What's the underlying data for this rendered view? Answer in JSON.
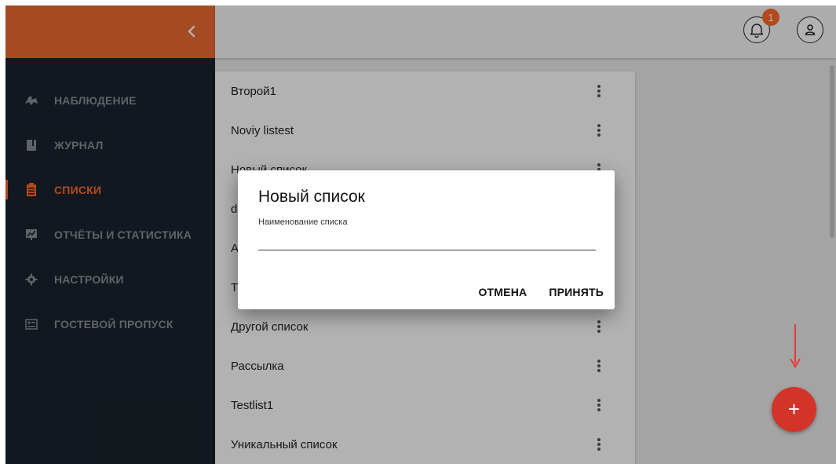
{
  "sidebar": {
    "collapse_icon": "chevron-left-icon",
    "items": [
      {
        "label": "НАБЛЮДЕНИЕ",
        "icon": "binoculars-icon",
        "active": false
      },
      {
        "label": "ЖУРНАЛ",
        "icon": "journal-icon",
        "active": false
      },
      {
        "label": "СПИСКИ",
        "icon": "clipboard-list-icon",
        "active": true
      },
      {
        "label": "ОТЧЁТЫ И СТАТИСТИКА",
        "icon": "chart-icon",
        "active": false
      },
      {
        "label": "НАСТРОЙКИ",
        "icon": "gear-icon",
        "active": false
      },
      {
        "label": "ГОСТЕВОЙ ПРОПУСК",
        "icon": "guest-pass-icon",
        "active": false
      }
    ]
  },
  "topbar": {
    "notification_count": "1",
    "bell_icon": "bell-icon",
    "user_icon": "user-icon"
  },
  "lists": [
    "Второй1",
    "Noviy listest",
    "Новый список",
    "d",
    "A",
    "T",
    "Другой список",
    "Рассылка",
    "Testlist1",
    "Уникальный список"
  ],
  "dialog": {
    "title": "Новый список",
    "field_label": "Наименование списка",
    "field_value": "",
    "cancel_label": "ОТМЕНА",
    "accept_label": "ПРИНЯТЬ"
  },
  "fab": {
    "label": "+",
    "icon": "plus-icon"
  },
  "colors": {
    "accent": "#ed6b33",
    "sidebar_bg": "#1b232d",
    "fab": "#d2342a",
    "annotation_arrow": "#e53935"
  }
}
